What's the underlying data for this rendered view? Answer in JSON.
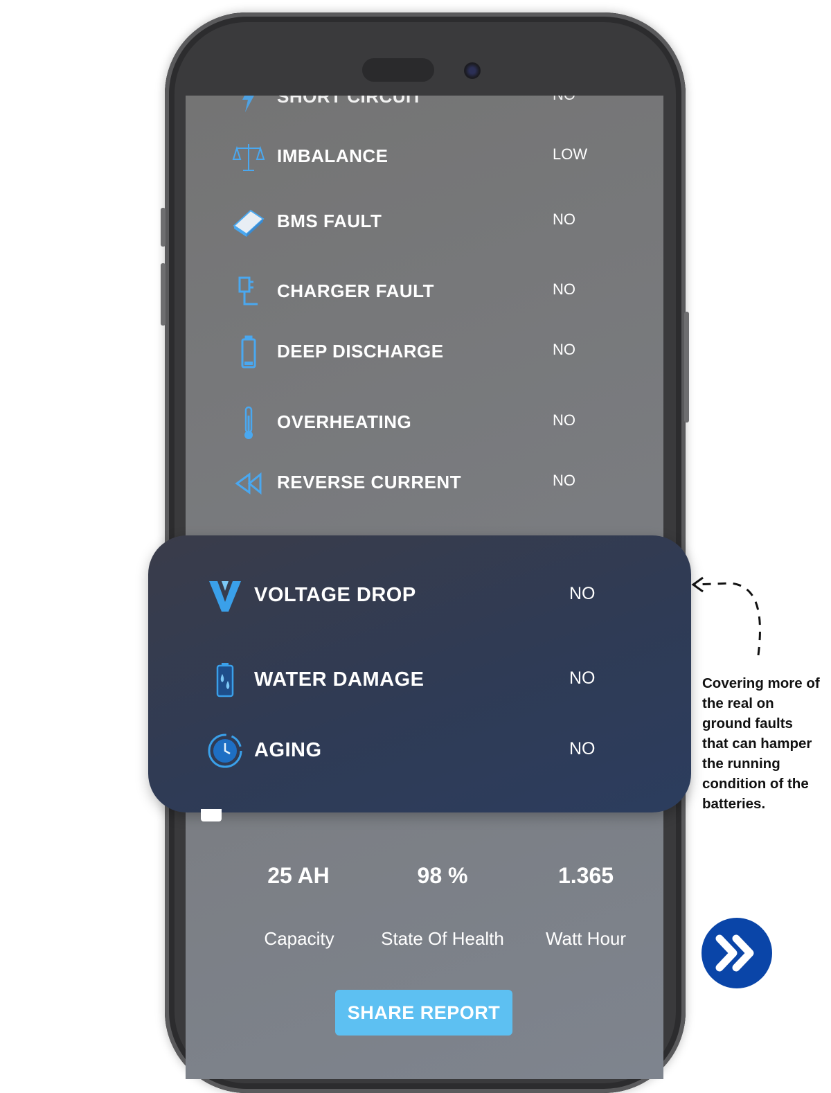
{
  "colors": {
    "accent": "#4aa8f0",
    "panel": "#2f3b55",
    "share_button": "#5dc0f2",
    "next_button": "#0a45a8"
  },
  "screen": {
    "partial_row": {
      "icon": "lightning-icon",
      "label": "SHORT CIRCUIT",
      "value": "NO"
    },
    "faults": [
      {
        "icon": "balance-scale-icon",
        "label": "IMBALANCE",
        "value": "LOW"
      },
      {
        "icon": "chip-icon",
        "label": "BMS FAULT",
        "value": "NO"
      },
      {
        "icon": "charger-plug-icon",
        "label": "CHARGER FAULT",
        "value": "NO"
      },
      {
        "icon": "battery-icon",
        "label": "DEEP DISCHARGE",
        "value": "NO"
      },
      {
        "icon": "thermometer-icon",
        "label": "OVERHEATING",
        "value": "NO"
      },
      {
        "icon": "rewind-icon",
        "label": "REVERSE CURRENT",
        "value": "NO"
      }
    ]
  },
  "panel": {
    "items": [
      {
        "icon": "voltage-v-icon",
        "label": "VOLTAGE DROP",
        "value": "NO"
      },
      {
        "icon": "water-battery-icon",
        "label": "WATER DAMAGE",
        "value": "NO"
      },
      {
        "icon": "clock-icon",
        "label": "AGING",
        "value": "NO"
      }
    ]
  },
  "stats": {
    "capacity": {
      "value": "25 AH",
      "label": "Capacity"
    },
    "health": {
      "value": "98 %",
      "label": "State Of Health"
    },
    "watt": {
      "value": "1.365",
      "label": "Watt Hour"
    }
  },
  "share_label": "SHARE REPORT",
  "annotation": "Covering more of the real on ground faults that can hamper the running condition of the batteries.",
  "next_icon": "double-chevron-right-icon"
}
